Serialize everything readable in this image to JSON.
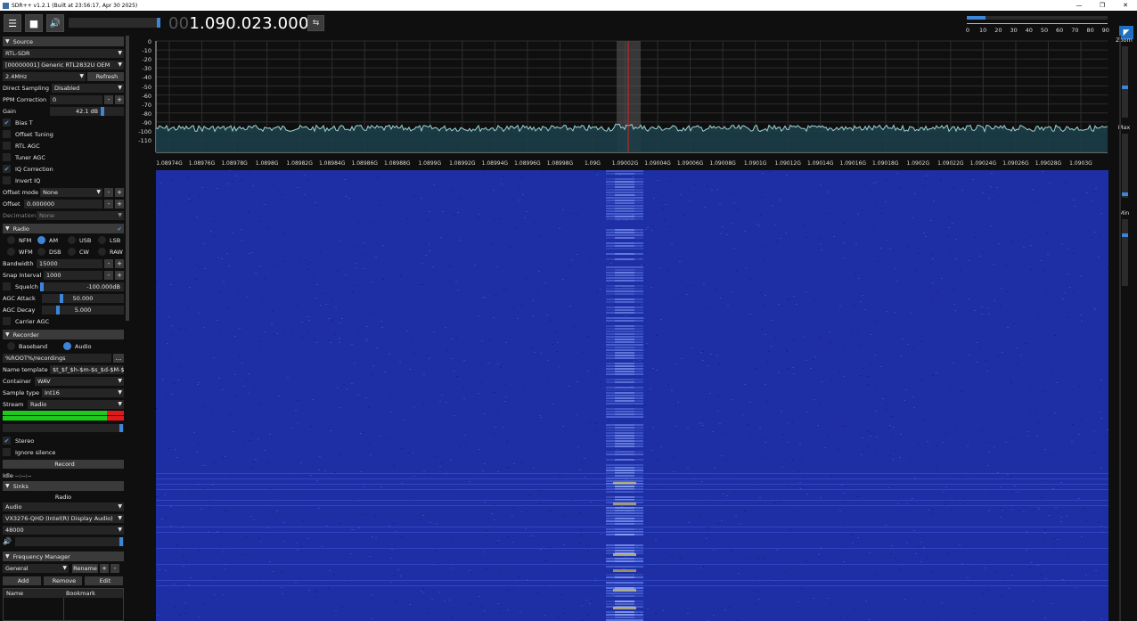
{
  "window": {
    "title": "SDR++ v1.2.1 (Built at 23:56:17, Apr 30 2025)",
    "min": "—",
    "max": "❐",
    "close": "✕"
  },
  "toolbar": {
    "menu_icon": "☰",
    "stop_icon": "■",
    "speaker_icon": "🔊",
    "volume": 0.97,
    "freq_dim": "00",
    "freq_main": "1.090.023.000",
    "swap_icon": "⇆"
  },
  "snr": {
    "ticks": [
      "0",
      "10",
      "20",
      "30",
      "40",
      "50",
      "60",
      "70",
      "80",
      "90"
    ],
    "level": 12
  },
  "source": {
    "header": "Source",
    "device_type": "RTL-SDR",
    "device": "[00000001] Generic RTL2832U OEM",
    "sample_rate": "2.4MHz",
    "refresh": "Refresh",
    "direct_sampling_label": "Direct Sampling",
    "direct_sampling": "Disabled",
    "ppm_label": "PPM Correction",
    "ppm": "0",
    "gain_label": "Gain",
    "gain": "42.1 dB",
    "bias_t": "Bias T",
    "offset_tuning": "Offset Tuning",
    "rtl_agc": "RTL AGC",
    "tuner_agc": "Tuner AGC",
    "iq_correction": "IQ Correction",
    "invert_iq": "Invert IQ",
    "offset_mode_label": "Offset mode",
    "offset_mode": "None",
    "offset_label": "Offset",
    "offset": "0.000000",
    "decimation_label": "Decimation",
    "decimation": "None"
  },
  "radio": {
    "header": "Radio",
    "modes": [
      "NFM",
      "AM",
      "USB",
      "LSB",
      "WFM",
      "DSB",
      "CW",
      "RAW"
    ],
    "selected_mode": "AM",
    "bandwidth_label": "Bandwidth",
    "bandwidth": "15000",
    "snap_label": "Snap Interval",
    "snap": "1000",
    "squelch_label": "Squelch",
    "squelch": "-100.000dB",
    "agc_attack_label": "AGC Attack",
    "agc_attack": "50.000",
    "agc_decay_label": "AGC Decay",
    "agc_decay": "5.000",
    "carrier_agc": "Carrier AGC"
  },
  "recorder": {
    "header": "Recorder",
    "baseband": "Baseband",
    "audio": "Audio",
    "path": "%ROOT%/recordings",
    "browse": "...",
    "name_template_label": "Name template",
    "name_template": "$t_$f_$h-$m-$s_$d-$M-$y",
    "container_label": "Container",
    "container": "WAV",
    "sample_type_label": "Sample type",
    "sample_type": "Int16",
    "stream_label": "Stream",
    "stream": "Radio",
    "stereo": "Stereo",
    "ignore_silence": "Ignore silence",
    "record": "Record",
    "status": "Idle --:--:--"
  },
  "sinks": {
    "header": "Sinks",
    "radio": "Radio",
    "sink_type": "Audio",
    "device": "VX3276-QHD (Intel(R) Display Audio)",
    "rate": "48000"
  },
  "freq_manager": {
    "header": "Frequency Manager",
    "list": "General",
    "rename": "Rename",
    "plus": "+",
    "minus": "-",
    "add": "Add",
    "remove": "Remove",
    "edit": "Edit",
    "col_name": "Name",
    "col_bookmark": "Bookmark"
  },
  "fft": {
    "ylabels": [
      "0",
      "-10",
      "-20",
      "-30",
      "-40",
      "-50",
      "-60",
      "-70",
      "-80",
      "-90",
      "-100",
      "-110"
    ],
    "xlabels": [
      "1.08974G",
      "1.08976G",
      "1.08978G",
      "1.0898G",
      "1.08982G",
      "1.08984G",
      "1.08986G",
      "1.08988G",
      "1.0899G",
      "1.08992G",
      "1.08994G",
      "1.08996G",
      "1.08998G",
      "1.09G",
      "1.09002G",
      "1.09004G",
      "1.09006G",
      "1.09008G",
      "1.0901G",
      "1.09012G",
      "1.09014G",
      "1.09016G",
      "1.09018G",
      "1.0902G",
      "1.09022G",
      "1.09024G",
      "1.09026G",
      "1.09028G",
      "1.0903G"
    ]
  },
  "right": {
    "zoom": "Zoom",
    "max": "Max",
    "min": "Min"
  },
  "colors": {
    "accent": "#3d85d8",
    "fft_line": "#9fd6d6",
    "fft_fill": "#1c3d47",
    "waterfall_bg": "#1e2fa6",
    "vfo_band": "#5a5a5a",
    "vfo_line": "#e02020"
  }
}
